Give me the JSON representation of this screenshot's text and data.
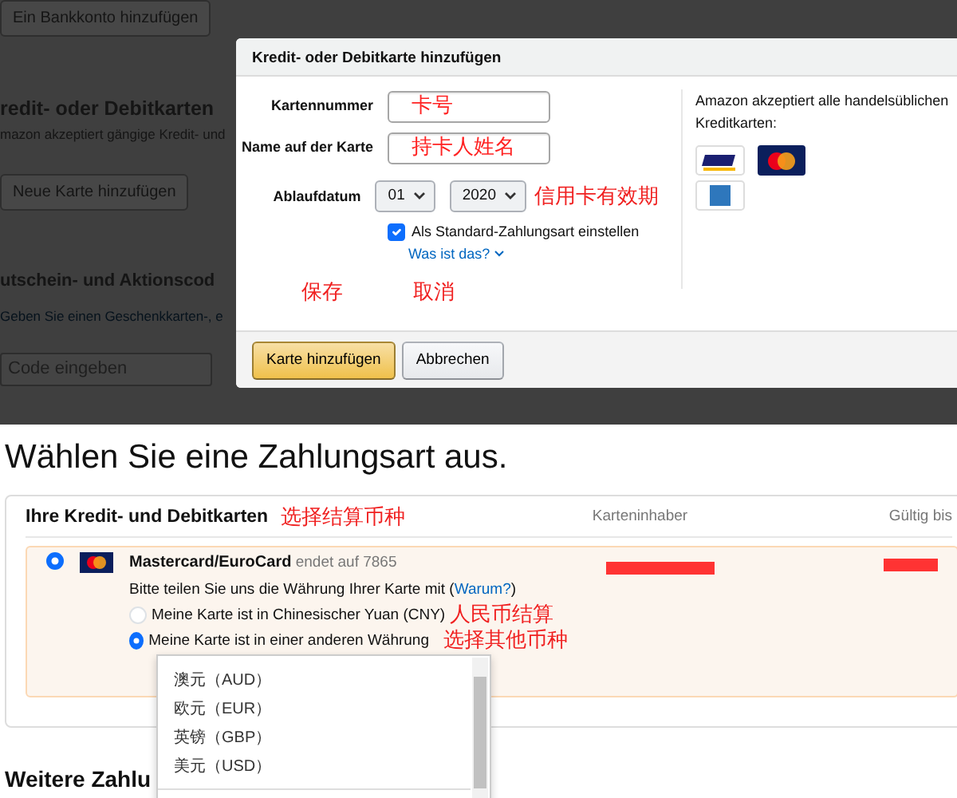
{
  "background_page": {
    "bank_button": "Ein Bankkonto hinzufügen",
    "cards_heading": "redit- oder Debitkarten",
    "cards_text": "mazon akzeptiert gängige Kredit- und",
    "new_card_button": "Neue Karte hinzufügen",
    "voucher_heading": "utschein- und Aktionscod",
    "voucher_text": "Geben Sie einen Geschenkkarten-, e",
    "code_field": {
      "placeholder": "Code eingeben"
    }
  },
  "dialog": {
    "title": "Kredit- oder Debitkarte hinzufügen",
    "fields": [
      {
        "label": "Kartennummer",
        "annotation": "卡号"
      },
      {
        "label": "Name auf der Karte",
        "annotation": "持卡人姓名"
      }
    ],
    "expiry": {
      "label": "Ablaufdatum",
      "month": "01",
      "year": "2020",
      "annotation": "信用卡有效期"
    },
    "default_checkbox": {
      "label": "Als Standard-Zahlungsart einstellen",
      "checked": true
    },
    "help_link": "Was ist das?",
    "accepted_text": "Amazon akzeptiert alle handelsüblichen Kreditkarten:",
    "card_logos": [
      {
        "kind": "visa"
      },
      {
        "kind": "mastercard"
      },
      {
        "kind": "amex"
      }
    ],
    "button_annotations": [
      "保存",
      "取消"
    ],
    "buttons": [
      {
        "label": "Karte hinzufügen",
        "kind": "primary"
      },
      {
        "label": "Abbrechen",
        "kind": "secondary"
      }
    ]
  },
  "payment": {
    "title": "Wählen Sie eine Zahlungsart aus.",
    "section": {
      "title": "Ihre Kredit- und Debitkarten",
      "annotation": "选择结算币种",
      "columns": [
        "Karteninhaber",
        "Gültig bis"
      ],
      "cards": [
        {
          "selected": true,
          "redacted": true,
          "brand": "Mastercard/EuroCard",
          "ending": "endet auf 7865",
          "prompt_before": "Bitte teilen Sie uns die Währung Ihrer Karte mit (",
          "why_link": "Warum?",
          "prompt_after": ")",
          "currency_options": [
            {
              "label": "Meine Karte ist in Chinesischer Yuan (CNY)",
              "selected": false,
              "annotation": "人民币结算"
            },
            {
              "label": "Meine Karte ist in einer anderen Währung",
              "selected": true,
              "annotation": "选择其他币种"
            }
          ]
        }
      ]
    },
    "currency_dropdown": {
      "options": [
        "澳元（AUD）",
        "欧元（EUR）",
        "英镑（GBP）",
        "美元（USD）"
      ]
    },
    "more_heading": "Weitere Zahlu"
  }
}
